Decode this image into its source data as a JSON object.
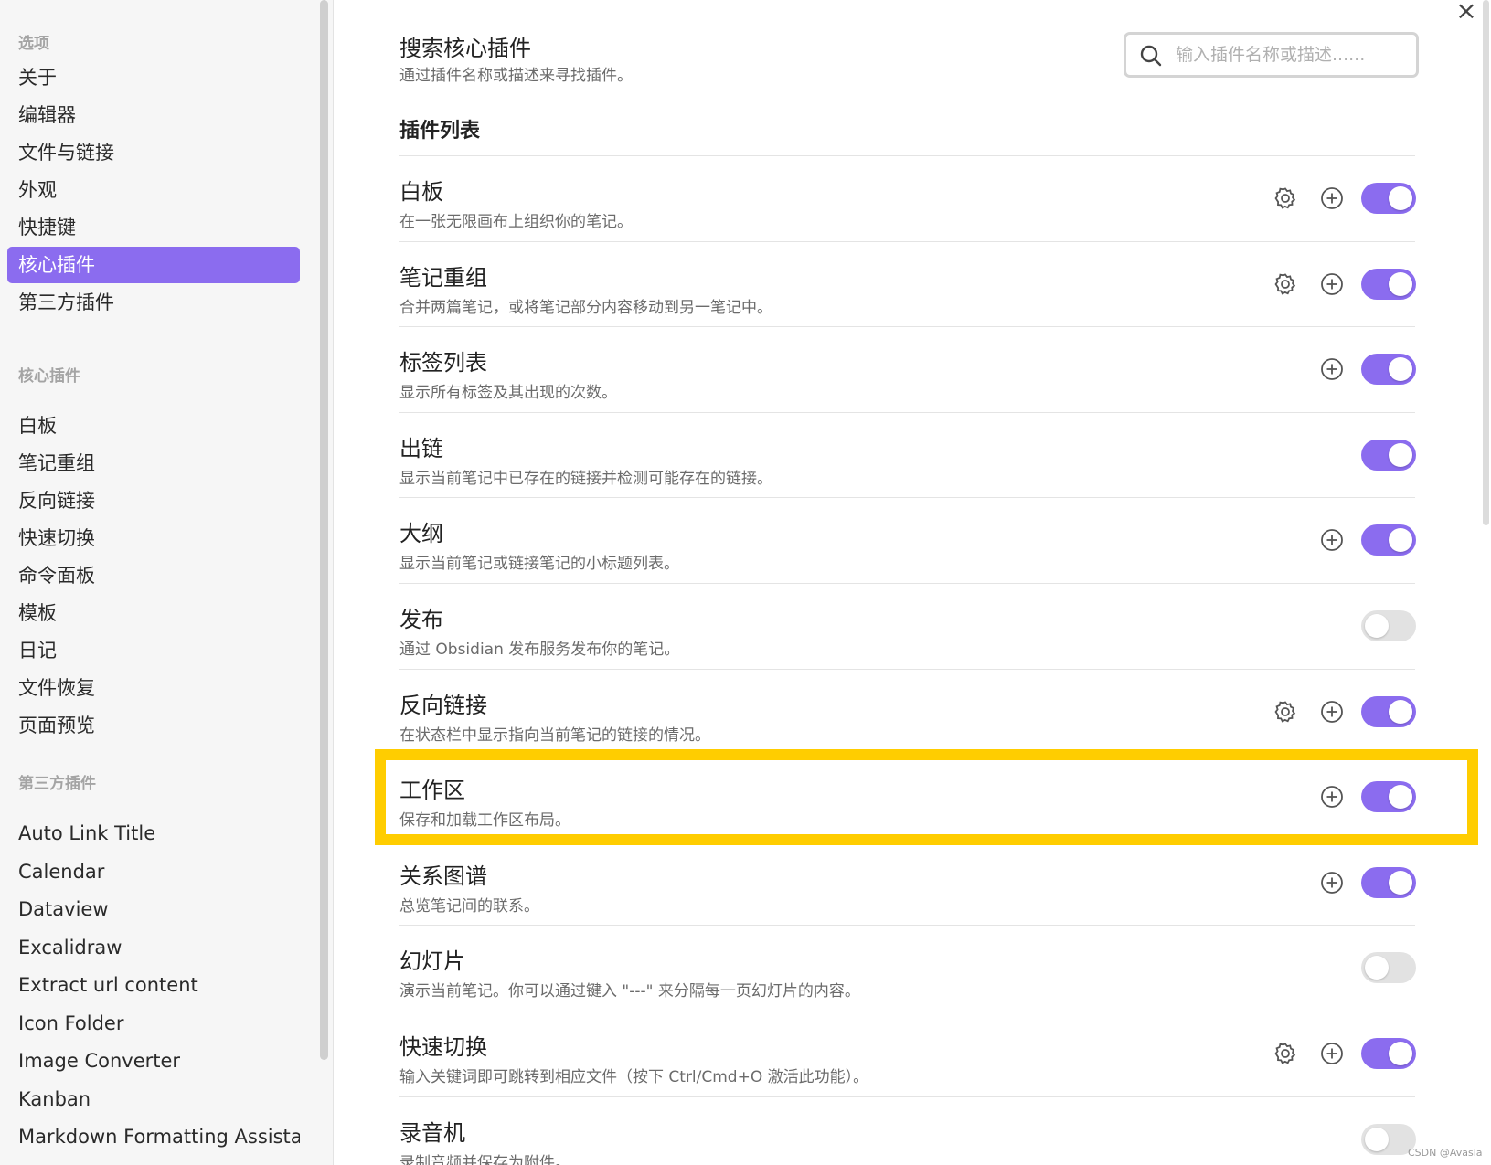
{
  "sidebar": {
    "section_options": "选项",
    "options": [
      {
        "label": "关于",
        "active": false
      },
      {
        "label": "编辑器",
        "active": false
      },
      {
        "label": "文件与链接",
        "active": false
      },
      {
        "label": "外观",
        "active": false
      },
      {
        "label": "快捷键",
        "active": false
      },
      {
        "label": "核心插件",
        "active": true
      },
      {
        "label": "第三方插件",
        "active": false
      }
    ],
    "section_core": "核心插件",
    "core_items": [
      "白板",
      "笔记重组",
      "反向链接",
      "快速切换",
      "命令面板",
      "模板",
      "日记",
      "文件恢复",
      "页面预览"
    ],
    "section_third": "第三方插件",
    "third_items": [
      "Auto Link Title",
      "Calendar",
      "Dataview",
      "Excalidraw",
      "Extract url content",
      "Icon Folder",
      "Image Converter",
      "Kanban",
      "Markdown Formatting Assistant"
    ]
  },
  "main": {
    "close_icon": "×",
    "search": {
      "title": "搜索核心插件",
      "desc": "通过插件名称或描述来寻找插件。",
      "placeholder": "输入插件名称或描述......",
      "icon": "search-icon"
    },
    "list_heading": "插件列表",
    "plugins": [
      {
        "name": "白板",
        "desc": "在一张无限画布上组织你的笔记。",
        "gear": true,
        "add": true,
        "enabled": true
      },
      {
        "name": "笔记重组",
        "desc": "合并两篇笔记，或将笔记部分内容移动到另一笔记中。",
        "gear": true,
        "add": true,
        "enabled": true
      },
      {
        "name": "标签列表",
        "desc": "显示所有标签及其出现的次数。",
        "gear": false,
        "add": true,
        "enabled": true
      },
      {
        "name": "出链",
        "desc": "显示当前笔记中已存在的链接并检测可能存在的链接。",
        "gear": false,
        "add": false,
        "enabled": true
      },
      {
        "name": "大纲",
        "desc": "显示当前笔记或链接笔记的小标题列表。",
        "gear": false,
        "add": true,
        "enabled": true
      },
      {
        "name": "发布",
        "desc": "通过 Obsidian 发布服务发布你的笔记。",
        "gear": false,
        "add": false,
        "enabled": false
      },
      {
        "name": "反向链接",
        "desc": "在状态栏中显示指向当前笔记的链接的情况。",
        "gear": true,
        "add": true,
        "enabled": true
      },
      {
        "name": "工作区",
        "desc": "保存和加载工作区布局。",
        "gear": false,
        "add": true,
        "enabled": true
      },
      {
        "name": "关系图谱",
        "desc": "总览笔记间的联系。",
        "gear": false,
        "add": true,
        "enabled": true
      },
      {
        "name": "幻灯片",
        "desc": "演示当前笔记。你可以通过键入 \"---\" 来分隔每一页幻灯片的内容。",
        "gear": false,
        "add": false,
        "enabled": false
      },
      {
        "name": "快速切换",
        "desc": "输入关键词即可跳转到相应文件（按下 Ctrl/Cmd+O 激活此功能）。",
        "gear": true,
        "add": true,
        "enabled": true
      },
      {
        "name": "录音机",
        "desc": "录制音频并保存为附件。",
        "gear": false,
        "add": false,
        "enabled": false
      }
    ],
    "highlighted_plugin": "工作区"
  },
  "colors": {
    "accent": "#8b6cef",
    "highlight": "#ffcd00",
    "toggle_off": "#e2e2e2"
  },
  "watermark": "CSDN @Avasla"
}
